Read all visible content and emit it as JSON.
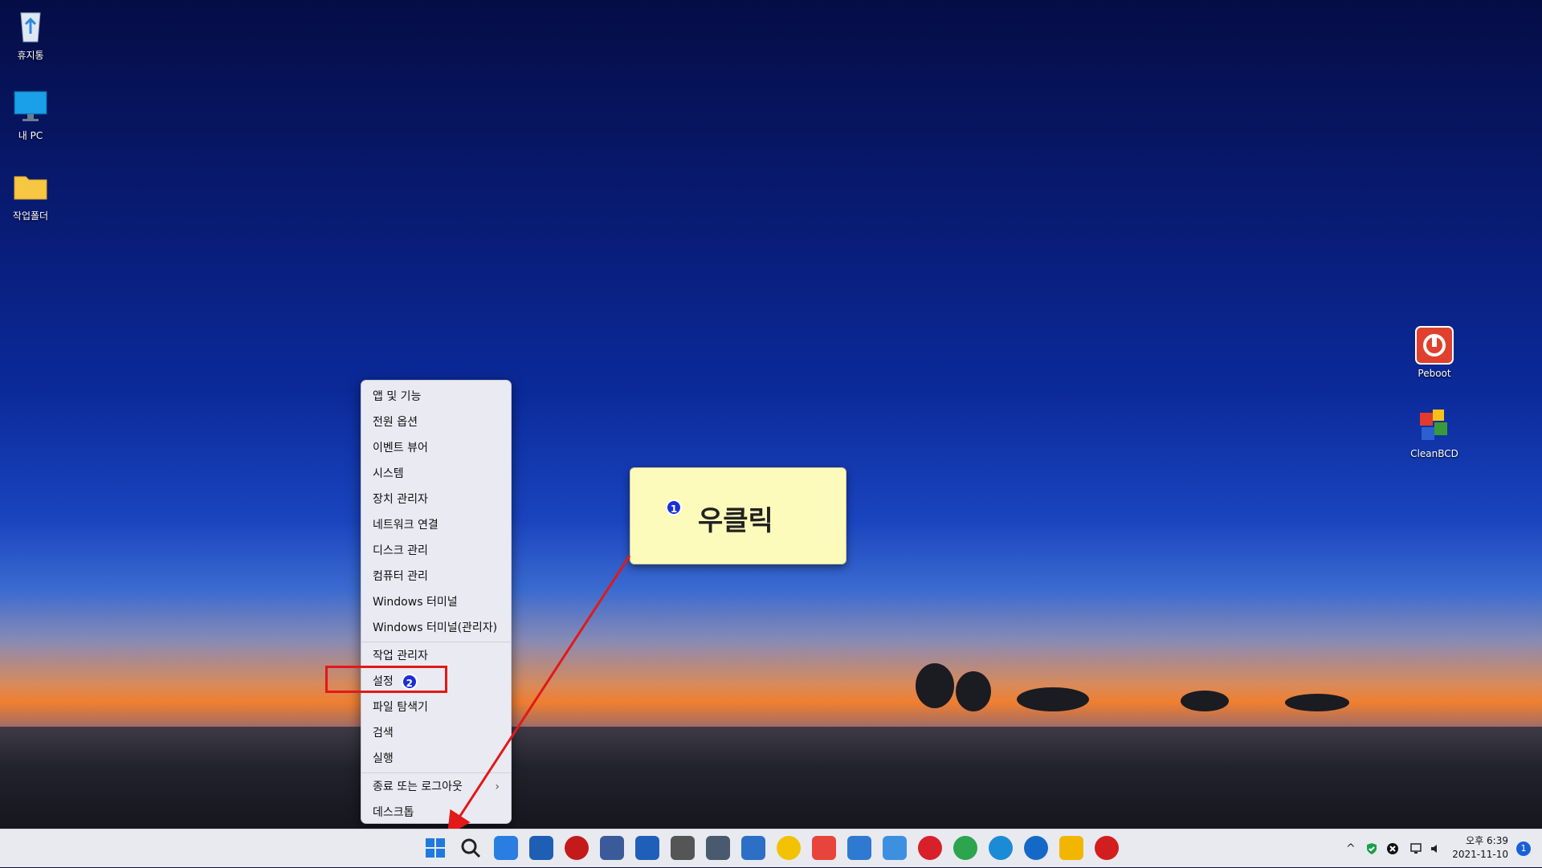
{
  "desktop": {
    "icons_left": [
      {
        "label": "휴지통",
        "icon": "recycle-bin-icon"
      },
      {
        "label": "내 PC",
        "icon": "computer-icon"
      },
      {
        "label": "작업폴더",
        "icon": "folder-icon"
      }
    ],
    "icons_right": [
      {
        "label": "Peboot",
        "icon": "power-shortcut-icon"
      },
      {
        "label": "CleanBCD",
        "icon": "cleanbcd-icon"
      }
    ]
  },
  "context_menu": {
    "items": [
      "앱 및 기능",
      "전원 옵션",
      "이벤트 뷰어",
      "시스템",
      "장치 관리자",
      "네트워크 연결",
      "디스크 관리",
      "컴퓨터 관리",
      "Windows 터미널",
      "Windows 터미널(관리자)",
      "작업 관리자",
      "설정",
      "파일 탐색기",
      "검색",
      "실행",
      "종료 또는 로그아웃",
      "데스크톱"
    ],
    "submenu_arrow": "›",
    "highlight_badge": "2"
  },
  "callout": {
    "badge": "1",
    "text": "우클릭"
  },
  "taskbar": {
    "icons": [
      "start-button-icon",
      "search-icon",
      "cortana-icon",
      "store-icon",
      "media-record-icon",
      "calculator-icon",
      "notepad-icon",
      "tool-icon",
      "settings-gear-icon",
      "security-shield-icon",
      "media-player-icon",
      "screenshot-app-icon",
      "paint-icon",
      "camera-icon",
      "opera-icon",
      "chrome-icon",
      "edge-icon",
      "edge-beta-icon",
      "file-explorer-icon",
      "power-icon"
    ],
    "icon_colors": [
      "#1f7ae0",
      "#222222",
      "#2a7de1",
      "#1e5fb3",
      "#c41a1a",
      "#3b5a9a",
      "#1f5fb9",
      "#555555",
      "#4a5a6e",
      "#2b6fc7",
      "#f2c200",
      "#e8443c",
      "#2e7ad0",
      "#3d90e0",
      "#d8202a",
      "#2da44e",
      "#1b8bd6",
      "#1469c7",
      "#f2b600",
      "#d21e1e"
    ],
    "tray": {
      "chevron": "^",
      "clock_time": "오후 6:39",
      "clock_date": "2021-11-10",
      "notifications": "1"
    }
  },
  "colors": {
    "highlight_red": "#e11919",
    "badge_blue": "#1a2fd6",
    "callout_bg": "#fdfbbc"
  }
}
